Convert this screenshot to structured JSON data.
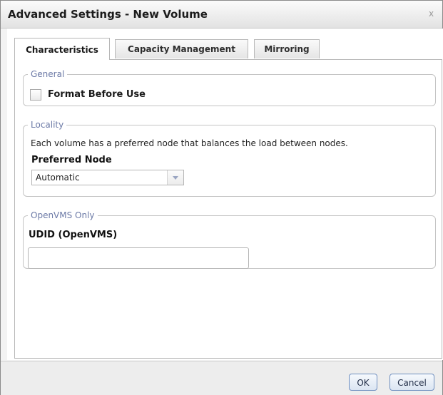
{
  "dialog": {
    "title": "Advanced Settings - New Volume",
    "close_glyph": "x"
  },
  "tabs": [
    {
      "label": "Characteristics",
      "active": true
    },
    {
      "label": "Capacity Management",
      "active": false
    },
    {
      "label": "Mirroring",
      "active": false
    }
  ],
  "general": {
    "legend": "General",
    "format_before_use": {
      "label": "Format Before Use",
      "checked": false
    }
  },
  "locality": {
    "legend": "Locality",
    "description": "Each volume has a preferred node that balances the load between nodes.",
    "preferred_node": {
      "label": "Preferred Node",
      "selected": "Automatic"
    }
  },
  "openvms": {
    "legend": "OpenVMS Only",
    "udid": {
      "label": "UDID (OpenVMS)",
      "value": "",
      "placeholder": ""
    }
  },
  "footer": {
    "ok_label": "OK",
    "cancel_label": "Cancel"
  },
  "colors": {
    "legend_text": "#6b79a6",
    "button_border": "#6f8fc0"
  },
  "icons": {
    "close": "close-icon",
    "dropdown": "chevron-down-icon"
  }
}
